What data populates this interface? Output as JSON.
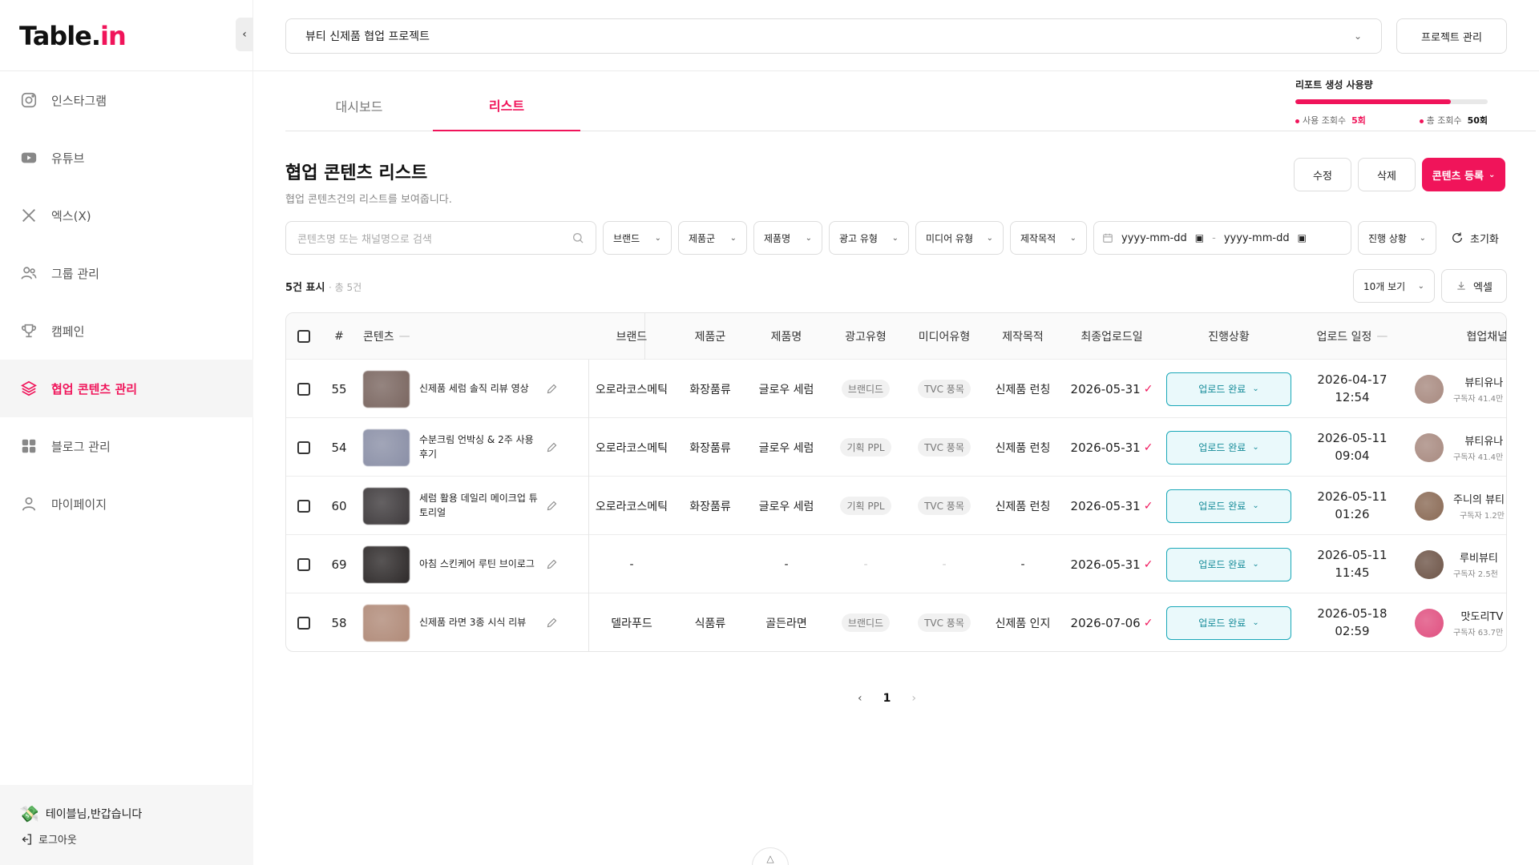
{
  "app": {
    "logo_main": "Table.",
    "logo_accent": "in"
  },
  "sidebar": {
    "items": [
      {
        "label": "인스타그램",
        "icon": "instagram-icon"
      },
      {
        "label": "유튜브",
        "icon": "youtube-icon"
      },
      {
        "label": "엑스(X)",
        "icon": "x-icon"
      },
      {
        "label": "그룹 관리",
        "icon": "group-icon"
      },
      {
        "label": "캠페인",
        "icon": "trophy-icon"
      },
      {
        "label": "협업 콘텐츠 관리",
        "icon": "layers-icon",
        "active": true
      },
      {
        "label": "블로그 관리",
        "icon": "grid-icon"
      },
      {
        "label": "마이페이지",
        "icon": "user-icon"
      }
    ],
    "greeting": "테이블님,반갑습니다",
    "logout": "로그아웃"
  },
  "topbar": {
    "project": "뷰티 신제품 협업 프로젝트",
    "project_manage": "프로젝트 관리"
  },
  "tabs": [
    {
      "label": "대시보드"
    },
    {
      "label": "리스트",
      "active": true
    }
  ],
  "usage": {
    "title": "리포트 생성 사용량",
    "used_label": "사용 조회수",
    "used_value": "5회",
    "total_label": "총 조회수",
    "total_value": "50회",
    "fill_fraction": 0.81,
    "accent_color": "#f0145a"
  },
  "page": {
    "title": "협업 콘텐츠 리스트",
    "subtitle": "협업 콘텐츠건의 리스트를 보여줍니다.",
    "edit": "수정",
    "delete": "삭제",
    "register": "콘텐츠 등록"
  },
  "filters": {
    "search_placeholder": "콘텐츠명 또는 채널명으로 검색",
    "brand": "브랜드",
    "product_group": "제품군",
    "product_name": "제품명",
    "ad_type": "광고 유형",
    "media_type": "미디어 유형",
    "purpose": "제작목적",
    "date_from": "yyyy-mm-dd",
    "date_to": "yyyy-mm-dd",
    "date_sep": "-",
    "status": "진행 상황",
    "reset": "초기화"
  },
  "list": {
    "shown": "5건 표시",
    "total": "· 총 5건",
    "page_size": "10개 보기",
    "excel": "엑셀"
  },
  "table": {
    "headers": {
      "num": "#",
      "content": "콘텐츠",
      "brand": "브랜드",
      "group": "제품군",
      "product": "제품명",
      "ad": "광고유형",
      "media": "미디어유형",
      "purpose": "제작목적",
      "last_upload": "최종업로드일",
      "status": "진행상황",
      "schedule": "업로드 일정",
      "channel": "협업채널"
    },
    "rows": [
      {
        "num": "55",
        "title": "신제품 세럼 솔직 리뷰 영상",
        "brand": "오로라코스메틱",
        "group": "화장품류",
        "product": "글로우 세럼",
        "ad": "브랜디드",
        "media": "TVC 풍목",
        "purpose": "신제품 런칭",
        "last_upload": "2026-05-31",
        "status": "업로드 완료",
        "date": "2026-04-17",
        "time": "12:54",
        "ch_name": "뷰티유나",
        "ch_sub": "구독자 41.4만",
        "thumb": "#7a6660",
        "avatar": "#a88a80"
      },
      {
        "num": "54",
        "title": "수분크림 언박싱 & 2주 사용 후기",
        "brand": "오로라코스메틱",
        "group": "화장품류",
        "product": "글로우 세럼",
        "ad": "기획 PPL",
        "media": "TVC 풍목",
        "purpose": "신제품 런칭",
        "last_upload": "2026-05-31",
        "status": "업로드 완료",
        "date": "2026-05-11",
        "time": "09:04",
        "ch_name": "뷰티유나",
        "ch_sub": "구독자 41.4만",
        "thumb": "#8a8fa6",
        "avatar": "#a88a80"
      },
      {
        "num": "60",
        "title": "세럼 활용 데일리 메이크업 튜토리얼",
        "brand": "오로라코스메틱",
        "group": "화장품류",
        "product": "글로우 세럼",
        "ad": "기획 PPL",
        "media": "TVC 풍목",
        "purpose": "신제품 런칭",
        "last_upload": "2026-05-31",
        "status": "업로드 완료",
        "date": "2026-05-11",
        "time": "01:26",
        "ch_name": "주니의 뷰티",
        "ch_sub": "구독자 1.2만",
        "thumb": "#3e3a3c",
        "avatar": "#8a6a55"
      },
      {
        "num": "69",
        "title": "아침 스킨케어 루틴 브이로그",
        "brand": "-",
        "group": "",
        "product": "-",
        "ad": "-",
        "media": "-",
        "purpose": "-",
        "last_upload": "2026-05-31",
        "status": "업로드 완료",
        "date": "2026-05-11",
        "time": "11:45",
        "ch_name": "루비뷰티",
        "ch_sub": "구독자 2.5천",
        "thumb": "#2e2a2a",
        "avatar": "#6e5548"
      },
      {
        "num": "58",
        "title": "신제품 라면 3종 시식 리뷰",
        "brand": "델라푸드",
        "group": "식품류",
        "product": "골든라면",
        "ad": "브랜디드",
        "media": "TVC 풍목",
        "purpose": "신제품 인지",
        "last_upload": "2026-07-06",
        "status": "업로드 완료",
        "date": "2026-05-18",
        "time": "02:59",
        "ch_name": "맛도리TV",
        "ch_sub": "구독자 63.7만",
        "thumb": "#b08a78",
        "avatar": "#e05080"
      }
    ]
  },
  "pagination": {
    "prev": "‹",
    "current": "1",
    "next": "›"
  }
}
